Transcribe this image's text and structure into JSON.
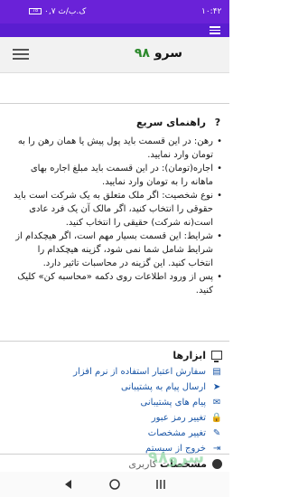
{
  "status": {
    "time": "۱۰:۴۲",
    "left_info": "۰,۷ ک.ب/ث",
    "battery": "78"
  },
  "brand": {
    "text": "سرو",
    "number": "۹۸"
  },
  "help": {
    "title": "راهنمای سریع",
    "items": [
      "رهن: در این قسمت باید پول پیش یا همان رهن را به تومان وارد نمایید.",
      "اجاره(تومان): در این قسمت باید مبلغ اجاره بهای ماهانه را به تومان وارد نمایید.",
      "نوع شخصیت: اگر ملک متعلق به یک شرکت است باید حقوقی را انتخاب کنید، اگر مالک آن یک فرد عادی است(نه شرکت) حقیقی را انتخاب کنید.",
      "شرایط: این قسمت بسیار مهم است، اگر هیچکدام از شرایط شامل شما نمی شود، گزینه هیچکدام را انتخاب کنید. این گزینه در محاسبات تاثیر دارد.",
      "پس از ورود اطلاعات روی دکمه «محاسبه کن» کلیک کنید."
    ]
  },
  "tools": {
    "title": "ابزارها",
    "items": [
      {
        "label": "سفارش اعتبار استفاده از نرم افزار",
        "icon": "doc-icon"
      },
      {
        "label": "ارسال پیام به پشتیبانی",
        "icon": "send-icon"
      },
      {
        "label": "پیام های پشتیبانی",
        "icon": "messages-icon"
      },
      {
        "label": "تغییر رمز عبور",
        "icon": "lock-icon"
      },
      {
        "label": "تغییر مشخصات",
        "icon": "edit-icon"
      },
      {
        "label": "خروج از سیستم",
        "icon": "logout-icon"
      }
    ]
  },
  "user": {
    "label": "مشخصات",
    "sub": "کاربری"
  },
  "watermark": "سرو۹۸",
  "colors": {
    "status": "#6a22d8",
    "link": "#1a56a6",
    "logo_green": "#2d8a2d"
  }
}
